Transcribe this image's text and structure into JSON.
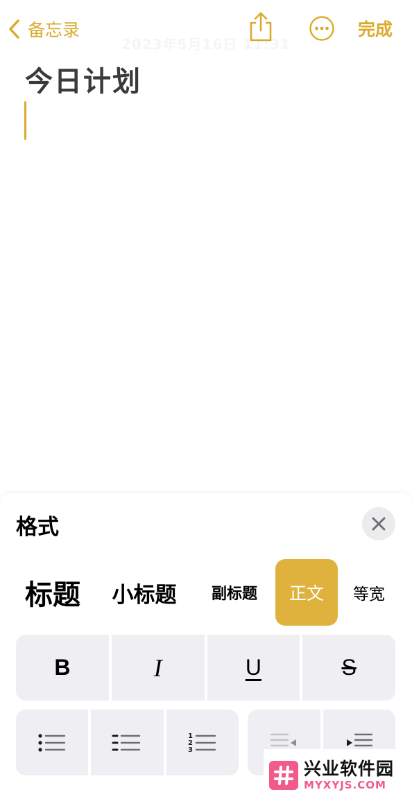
{
  "nav": {
    "back_label": "备忘录",
    "done_label": "完成",
    "date_text": "2023年5月16日 11:31"
  },
  "note": {
    "title": "今日计划"
  },
  "format_sheet": {
    "title": "格式",
    "styles": [
      "标题",
      "小标题",
      "副标题",
      "正文",
      "等宽"
    ],
    "selected_style": "正文",
    "text_buttons": [
      "B",
      "I",
      "U",
      "S"
    ]
  },
  "watermark": {
    "main": "兴业软件园",
    "sub": "MYXYJS.COM"
  },
  "colors": {
    "accent": "#d9ab2c",
    "selected_bg": "#deb23c",
    "button_bg": "#efeff3",
    "watermark": "#f25a8a"
  }
}
